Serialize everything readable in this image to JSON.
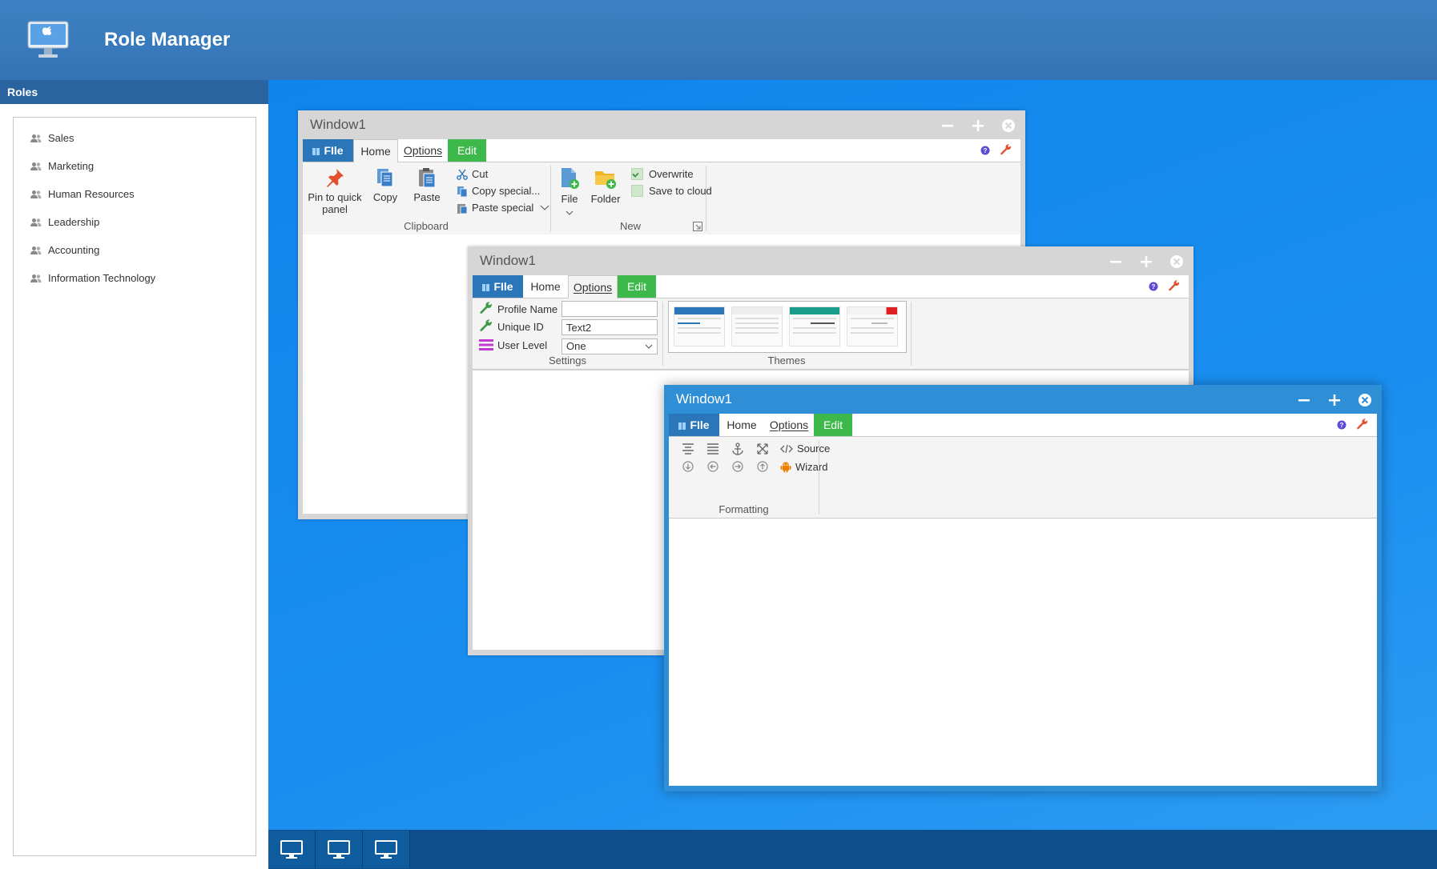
{
  "app": {
    "title": "Role Manager"
  },
  "sidebar": {
    "header": "Roles",
    "roles": [
      "Sales",
      "Marketing",
      "Human Resources",
      "Leadership",
      "Accounting",
      "Information Technology"
    ]
  },
  "window1": {
    "title": "Window1",
    "tabs": {
      "file": "FIle",
      "home": "Home",
      "options": "Options",
      "edit": "Edit"
    },
    "clipboard": {
      "pin": "Pin to quick panel",
      "copy": "Copy",
      "paste": "Paste",
      "cut": "Cut",
      "copy_special": "Copy special...",
      "paste_special": "Paste special",
      "label": "Clipboard"
    },
    "new_group": {
      "file": "File",
      "folder": "Folder",
      "overwrite": "Overwrite",
      "save_to_cloud": "Save to cloud",
      "label": "New"
    }
  },
  "window2": {
    "title": "Window1",
    "tabs": {
      "file": "FIle",
      "home": "Home",
      "options": "Options",
      "edit": "Edit"
    },
    "settings": {
      "profile_name_label": "Profile Name",
      "profile_name_value": "",
      "unique_id_label": "Unique ID",
      "unique_id_value": "Text2",
      "user_level_label": "User Level",
      "user_level_value": "One",
      "label": "Settings"
    },
    "themes": {
      "label": "Themes"
    }
  },
  "window3": {
    "title": "Window1",
    "tabs": {
      "file": "FIle",
      "home": "Home",
      "options": "Options",
      "edit": "Edit"
    },
    "formatting": {
      "source": "Source",
      "wizard": "Wizard",
      "label": "Formatting"
    }
  },
  "colors": {
    "header": "#3474b6",
    "desktop": "#1a8ef0",
    "file_tab": "#2b76b8",
    "edit_tab": "#3cb94a",
    "active_titlebar": "#2f8fd6",
    "inactive_titlebar": "#d6d6d6",
    "taskbar": "#0d4f8c"
  }
}
